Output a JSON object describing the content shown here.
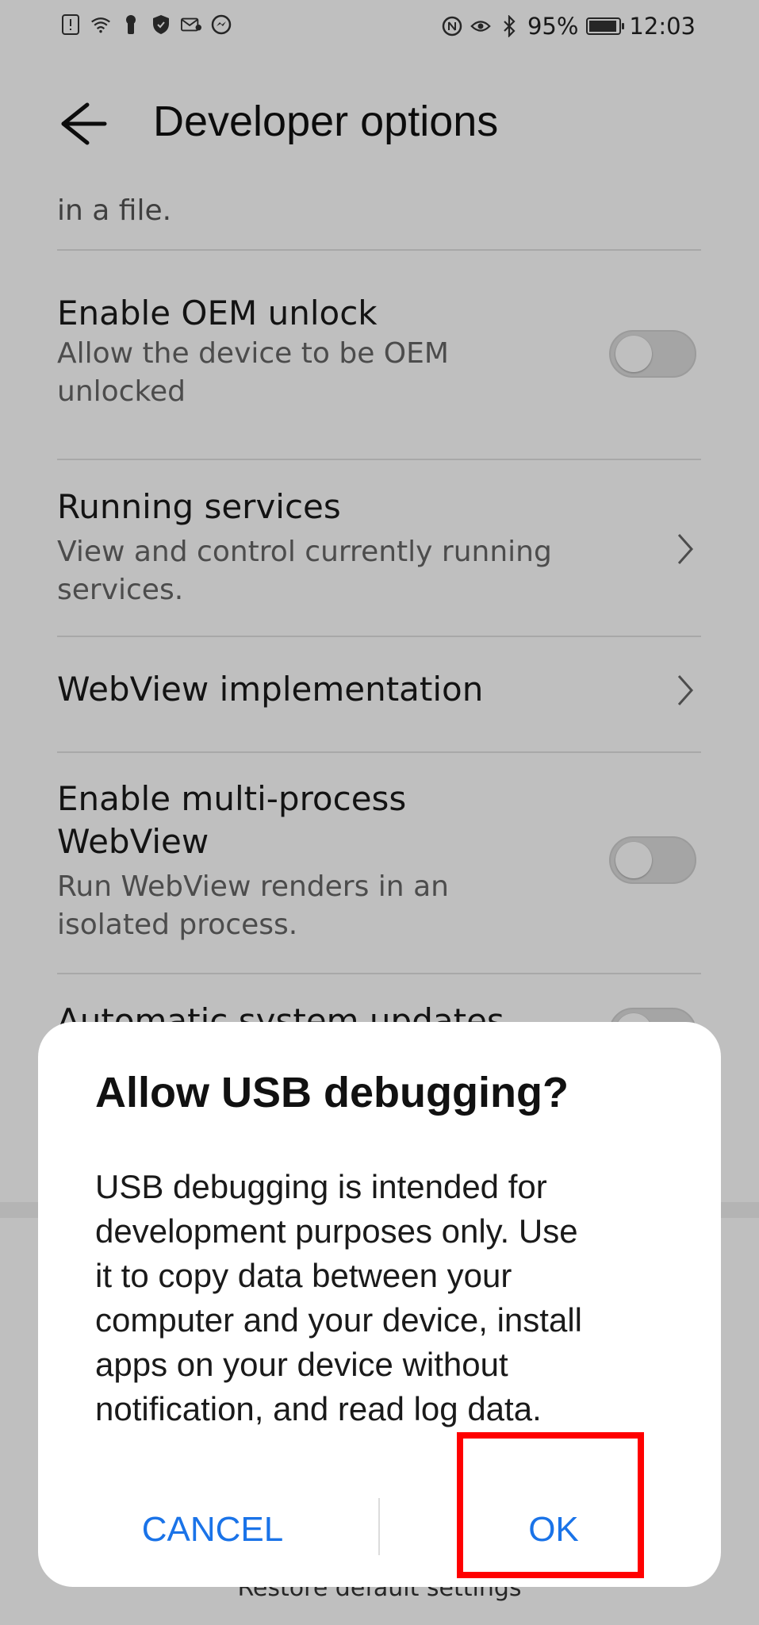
{
  "status_bar": {
    "battery": "95%",
    "time": "12:03",
    "battery_level": 0.95,
    "left_icons": [
      "sim-alert-icon",
      "wifi-icon",
      "keyhole-icon",
      "shield-icon",
      "mail-icon",
      "messenger-icon"
    ],
    "right_icons": [
      "nfc-icon",
      "eye-icon",
      "bluetooth-icon"
    ]
  },
  "header": {
    "back_icon": "arrow-left-icon",
    "title": "Developer options"
  },
  "settings": {
    "partial_top": "in a file.",
    "oem_unlock": {
      "title": "Enable OEM unlock",
      "subtitle_line1": "Allow the device to be OEM",
      "subtitle_line2": "unlocked",
      "enabled": false
    },
    "running_services": {
      "title": "Running services",
      "subtitle_line1": "View and control currently running",
      "subtitle_line2": "services."
    },
    "webview_impl": {
      "title": "WebView implementation"
    },
    "multi_process": {
      "title_line1": "Enable multi-process",
      "title_line2": "WebView",
      "subtitle_line1": "Run WebView renders in an",
      "subtitle_line2": "isolated process.",
      "enabled": false
    },
    "partial_hidden": "Automatic system updates"
  },
  "footer": {
    "restore_label": "Restore default settings"
  },
  "dialog": {
    "title": "Allow USB debugging?",
    "body_line1": "USB debugging is intended for",
    "body_line2": "development purposes only. Use",
    "body_line3": "it to copy data between your",
    "body_line4": "computer and your device, install",
    "body_line5": "apps on your device without",
    "body_line6": "notification, and read log data.",
    "cancel_label": "CANCEL",
    "ok_label": "OK"
  },
  "colors": {
    "accent": "#1a73e8",
    "highlight": "#ff0000"
  }
}
